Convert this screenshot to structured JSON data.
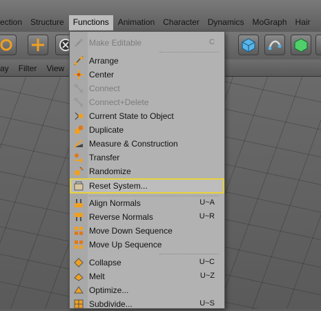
{
  "menubar": {
    "items": [
      {
        "label": "ection",
        "active": false
      },
      {
        "label": "Structure",
        "active": false
      },
      {
        "label": "Functions",
        "active": true
      },
      {
        "label": "Animation",
        "active": false
      },
      {
        "label": "Character",
        "active": false
      },
      {
        "label": "Dynamics",
        "active": false
      },
      {
        "label": "MoGraph",
        "active": false
      },
      {
        "label": "Hair",
        "active": false
      }
    ]
  },
  "subbar": {
    "items": [
      {
        "label": "ay"
      },
      {
        "label": "Filter"
      },
      {
        "label": "View"
      }
    ]
  },
  "menu": {
    "items": [
      {
        "label": "Make Editable",
        "shortcut": "C",
        "disabled": true
      },
      {
        "label": "Arrange",
        "shortcut": "",
        "disabled": false
      },
      {
        "label": "Center",
        "shortcut": "",
        "disabled": false
      },
      {
        "label": "Connect",
        "shortcut": "",
        "disabled": true
      },
      {
        "label": "Connect+Delete",
        "shortcut": "",
        "disabled": true
      },
      {
        "label": "Current State to Object",
        "shortcut": "",
        "disabled": false
      },
      {
        "label": "Duplicate",
        "shortcut": "",
        "disabled": false
      },
      {
        "label": "Measure & Construction",
        "shortcut": "",
        "disabled": false
      },
      {
        "label": "Transfer",
        "shortcut": "",
        "disabled": false
      },
      {
        "label": "Randomize",
        "shortcut": "",
        "disabled": false
      },
      {
        "label": "Reset System...",
        "shortcut": "",
        "disabled": false,
        "highlighted": true
      },
      {
        "label": "Align Normals",
        "shortcut": "U~A",
        "disabled": false
      },
      {
        "label": "Reverse Normals",
        "shortcut": "U~R",
        "disabled": false
      },
      {
        "label": "Move Down Sequence",
        "shortcut": "",
        "disabled": false
      },
      {
        "label": "Move Up Sequence",
        "shortcut": "",
        "disabled": false
      },
      {
        "label": "Collapse",
        "shortcut": "U~C",
        "disabled": false
      },
      {
        "label": "Melt",
        "shortcut": "U~Z",
        "disabled": false
      },
      {
        "label": "Optimize...",
        "shortcut": "",
        "disabled": false
      },
      {
        "label": "Subdivide...",
        "shortcut": "U~S",
        "disabled": false
      }
    ]
  },
  "colors": {
    "highlight_border": "#e8d23a",
    "menu_bg": "#b2b2b2",
    "menubar_active_bg": "#bcbcbc"
  }
}
